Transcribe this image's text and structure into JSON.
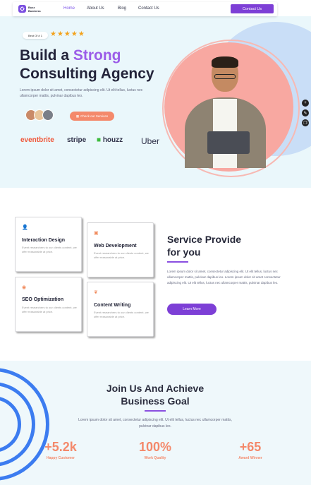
{
  "nav": {
    "logo_line1": "Buzz",
    "logo_line2": "Business",
    "links": [
      "Home",
      "About Us",
      "Blog",
      "Contact Us"
    ],
    "contact_btn": "Contact Us"
  },
  "hero": {
    "badge": "Best Of # 1",
    "stars": "★★★★★",
    "title_prefix": "Build a ",
    "title_accent": "Strong",
    "title_line2": "Consulting Agency",
    "description": "Lorem ipsum dolor sit amet, consectetur adipiscing elit. Ut elit tellus, luctus nec ullamcorper mattis, pulvinar dapibus leo.",
    "check_btn": "Check our Services",
    "brands": [
      "eventbrite",
      "stripe",
      "houzz",
      "Uber"
    ]
  },
  "services": {
    "cards": [
      {
        "title": "Interaction Design",
        "text": "Event researchers to our clients content, we offer reasonable at price."
      },
      {
        "title": "Web Development",
        "text": "Event researchers to our clients content, we offer reasonable at price."
      },
      {
        "title": "SEO Optimization",
        "text": "Event researchers to our clients content, we offer reasonable at price."
      },
      {
        "title": "Content Writing",
        "text": "Event researchers to our clients content, we offer reasonable at price."
      }
    ],
    "title_line1": "Service Provide",
    "title_line2": "for you",
    "description": "Lorem ipsum dolor sit amet, consectetur adipiscing elit. Ut elit tellus, luctus nec ullamcorper mattis, pulvinar dapibus leo. Lorem ipsum dolor sit amet consectetur adipiscing elit. Ut elit tellus, luctus nec ullamcorper mattis, pulvinar dapibus leo.",
    "learn_btn": "Learn More"
  },
  "join": {
    "title_line1": "Join Us And Achieve",
    "title_line2": "Business Goal",
    "description": "Lorem ipsum dolor sit amet, consectetur adipiscing elit. Ut elit tellus, luctus nec ullamcorper mattis, pulvinar dapibus leo.",
    "stats": [
      {
        "number": "+5.2k",
        "label": "Happy Customer"
      },
      {
        "number": "100%",
        "label": "Work Quality"
      },
      {
        "number": "+65",
        "label": "Award Winner"
      }
    ]
  },
  "colors": {
    "accent": "#7d3fd6",
    "coral": "#f4896b",
    "hero_bg": "#eaf7fb"
  }
}
